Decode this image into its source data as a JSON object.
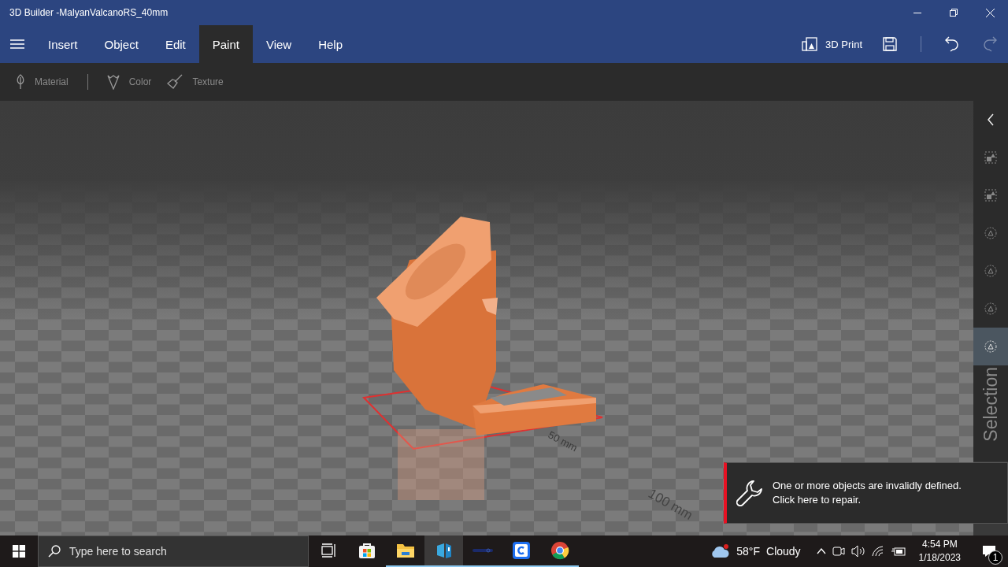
{
  "window": {
    "title": "3D Builder -MalyanValcanoRS_40mm"
  },
  "menu": {
    "tabs": [
      {
        "label": "Insert",
        "selected": false
      },
      {
        "label": "Object",
        "selected": false
      },
      {
        "label": "Edit",
        "selected": false
      },
      {
        "label": "Paint",
        "selected": true
      },
      {
        "label": "View",
        "selected": false
      },
      {
        "label": "Help",
        "selected": false
      }
    ],
    "print_label": "3D Print",
    "undo": {
      "disabled": false
    },
    "redo": {
      "disabled": true
    }
  },
  "toolbar": {
    "tools": [
      {
        "kind": "material",
        "label": "Material",
        "disabled": true
      },
      {
        "kind": "color",
        "label": "Color",
        "disabled": true
      },
      {
        "kind": "texture",
        "label": "Texture",
        "disabled": true
      }
    ]
  },
  "viewport": {
    "axis_labels": [
      "50 mm",
      "100 mm"
    ]
  },
  "side_panel": {
    "label": "Selection",
    "items": [
      {
        "kind": "collapse",
        "selected": false
      },
      {
        "kind": "square",
        "selected": false
      },
      {
        "kind": "square",
        "selected": false
      },
      {
        "kind": "circle",
        "selected": false
      },
      {
        "kind": "circle",
        "selected": false
      },
      {
        "kind": "circle",
        "selected": false
      },
      {
        "kind": "circle",
        "selected": true
      }
    ]
  },
  "notification": {
    "message": "One or more objects are invalidly defined.",
    "action": "Click here to repair."
  },
  "taskbar": {
    "search": {
      "placeholder": "Type here to search"
    },
    "apps": [
      {
        "kind": "store",
        "running": false,
        "selected": false
      },
      {
        "kind": "folder",
        "running": true,
        "selected": false
      },
      {
        "kind": "builder",
        "running": true,
        "selected": true
      },
      {
        "kind": "dark",
        "running": true,
        "selected": false
      },
      {
        "kind": "c-app",
        "running": true,
        "selected": false
      },
      {
        "kind": "browser",
        "running": true,
        "selected": false
      }
    ],
    "weather": {
      "temperature": "58°F",
      "condition": "Cloudy"
    },
    "time": "4:54 PM",
    "date": "1/18/2023",
    "notification_count": "1"
  }
}
